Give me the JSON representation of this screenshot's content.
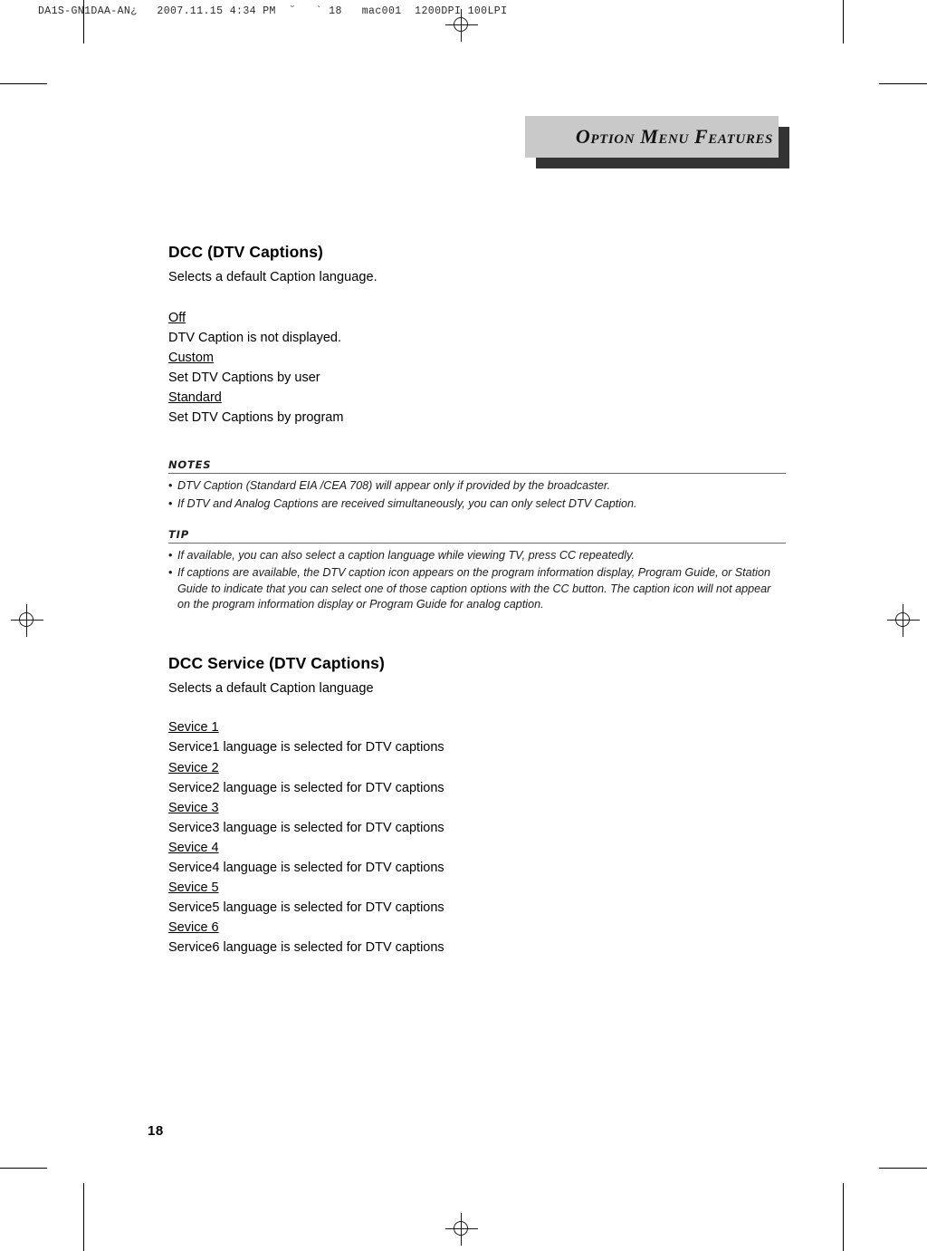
{
  "film_slug": "DA1S-GN1DAA-AN¿   2007.11.15 4:34 PM  ˘   ` 18   mac001  1200DPI 100LPI",
  "banner": {
    "title": "Option Menu Features",
    "background_color": "#c9c9c9",
    "shadow_color": "#333333"
  },
  "sections": [
    {
      "title": "DCC (DTV Captions)",
      "subtitle": "Selects a default Caption language.",
      "options": [
        {
          "term": "Off",
          "desc": "DTV Caption is not displayed."
        },
        {
          "term": "Custom",
          "desc": "Set DTV Captions by user"
        },
        {
          "term": "Standard",
          "desc": "Set DTV Captions by program"
        }
      ]
    },
    {
      "title": "DCC Service (DTV Captions)",
      "subtitle": "Selects a default Caption language",
      "options": [
        {
          "term": "Sevice 1",
          "desc": "Service1 language is selected for DTV captions"
        },
        {
          "term": "Sevice 2",
          "desc": "Service2 language is selected for DTV captions"
        },
        {
          "term": "Sevice 3",
          "desc": "Service3 language is selected for DTV captions"
        },
        {
          "term": "Sevice 4",
          "desc": "Service4 language is selected for DTV captions"
        },
        {
          "term": "Sevice 5",
          "desc": "Service5 language is selected for DTV captions"
        },
        {
          "term": "Sevice 6",
          "desc": "Service6 language is selected for DTV captions"
        }
      ]
    }
  ],
  "notes": {
    "label": "NOTES",
    "bullet": "•",
    "items": [
      "DTV Caption (Standard EIA /CEA 708) will appear only if provided by the broadcaster.",
      "If DTV and Analog Captions are received simultaneously, you can only select DTV Caption."
    ]
  },
  "tip": {
    "label": "TIP",
    "bullet": "•",
    "items": [
      "If available, you can also select a caption language while viewing TV, press CC repeatedly.",
      "If captions are available, the DTV caption icon appears on the program information display, Program Guide, or Station Guide to indicate that you can select one of those caption options with the CC button. The caption icon will not appear on the program information display or Program Guide for analog caption."
    ]
  },
  "page_number": "18"
}
